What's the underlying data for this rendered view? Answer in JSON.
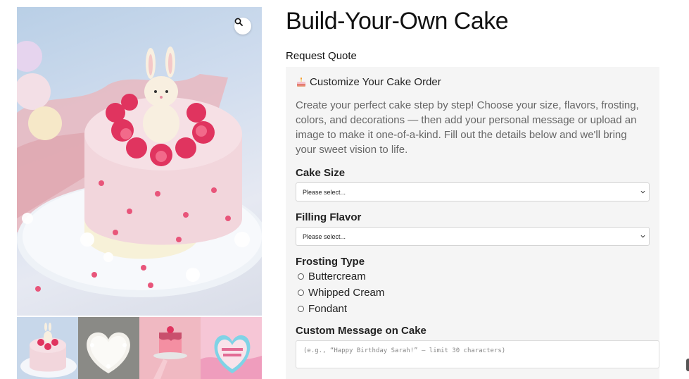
{
  "product": {
    "title": "Build-Your-Own Cake",
    "request_quote_label": "Request Quote"
  },
  "gallery": {
    "zoom_icon": "magnifier-icon",
    "main_image_alt": "pink-bunny-cake-photo",
    "thumbnails": [
      "pink-bunny-cake",
      "white-heart-cake",
      "pink-drip-cake",
      "heart-cookie-cake"
    ]
  },
  "customizer": {
    "title": "Customize Your Cake Order",
    "title_icon": "cake-emoji-icon",
    "description": "Create your perfect cake step by step! Choose your size, flavors, frosting, colors, and decorations — then add your personal message or upload an image to make it one-of-a-kind. Fill out the details below and we'll bring your sweet vision to life.",
    "fields": {
      "cake_size": {
        "label": "Cake Size",
        "value": "Please select..."
      },
      "filling_flavor": {
        "label": "Filling Flavor",
        "value": "Please select..."
      },
      "frosting_type": {
        "label": "Frosting Type",
        "options": [
          "Buttercream",
          "Whipped Cream",
          "Fondant"
        ]
      },
      "custom_message": {
        "label": "Custom Message on Cake",
        "placeholder": "(e.g., “Happy Birthday Sarah!” — limit 30 characters)"
      }
    }
  },
  "colors": {
    "box_background": "#f5f5f5",
    "title_text": "#111111",
    "description_text": "#666666"
  }
}
